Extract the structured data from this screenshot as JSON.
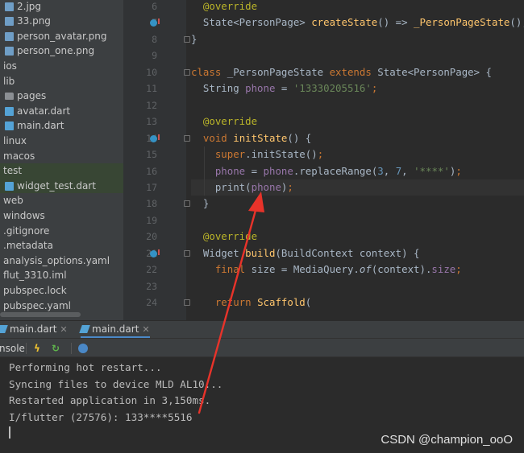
{
  "project_tree": {
    "items": [
      {
        "label": "2.jpg",
        "icon": "image-file-icon",
        "indent": 1
      },
      {
        "label": "33.png",
        "icon": "image-file-icon",
        "indent": 1
      },
      {
        "label": "person_avatar.png",
        "icon": "image-file-icon",
        "indent": 1
      },
      {
        "label": "person_one.png",
        "icon": "image-file-icon",
        "indent": 1
      },
      {
        "label": "ios",
        "icon": "",
        "indent": 0
      },
      {
        "label": "lib",
        "icon": "",
        "indent": 0
      },
      {
        "label": "pages",
        "icon": "folder-icon",
        "indent": 1
      },
      {
        "label": "avatar.dart",
        "icon": "dart-file-icon",
        "indent": 1
      },
      {
        "label": "main.dart",
        "icon": "dart-file-icon",
        "indent": 1
      },
      {
        "label": "linux",
        "icon": "",
        "indent": 0
      },
      {
        "label": "macos",
        "icon": "",
        "indent": 0
      },
      {
        "label": "test",
        "icon": "",
        "indent": 0,
        "selected": true
      },
      {
        "label": "widget_test.dart",
        "icon": "dart-file-icon",
        "indent": 1,
        "selected": true
      },
      {
        "label": "web",
        "icon": "",
        "indent": 0
      },
      {
        "label": "windows",
        "icon": "",
        "indent": 0
      },
      {
        "label": ".gitignore",
        "icon": "",
        "indent": 0
      },
      {
        "label": ".metadata",
        "icon": "",
        "indent": 0
      },
      {
        "label": "analysis_options.yaml",
        "icon": "",
        "indent": 0
      },
      {
        "label": "flut_3310.iml",
        "icon": "",
        "indent": 0
      },
      {
        "label": "pubspec.lock",
        "icon": "",
        "indent": 0
      },
      {
        "label": "pubspec.yaml",
        "icon": "",
        "indent": 0
      }
    ]
  },
  "editor": {
    "line_numbers": [
      "6",
      "7",
      "8",
      "9",
      "10",
      "11",
      "12",
      "13",
      "14",
      "15",
      "16",
      "17",
      "18",
      "19",
      "20",
      "21",
      "22",
      "23",
      "24"
    ],
    "lines": [
      [
        {
          "t": "  "
        },
        {
          "t": "@override",
          "c": "ann"
        }
      ],
      [
        {
          "t": "  State<PersonPage> "
        },
        {
          "t": "createState",
          "c": "fn"
        },
        {
          "t": "() => "
        },
        {
          "t": "_PersonPageState",
          "c": "fn"
        },
        {
          "t": "();"
        }
      ],
      [
        {
          "t": "}"
        }
      ],
      [
        {
          "t": ""
        }
      ],
      [
        {
          "t": "class ",
          "c": "kw"
        },
        {
          "t": "_PersonPageState "
        },
        {
          "t": "extends ",
          "c": "kw"
        },
        {
          "t": "State<PersonPage> {"
        }
      ],
      [
        {
          "t": "  String "
        },
        {
          "t": "phone",
          "c": "fld"
        },
        {
          "t": " = "
        },
        {
          "t": "'13330205516'",
          "c": "str"
        },
        {
          "t": ";",
          "c": "kw"
        }
      ],
      [
        {
          "t": ""
        }
      ],
      [
        {
          "t": "  "
        },
        {
          "t": "@override",
          "c": "ann"
        }
      ],
      [
        {
          "t": "  "
        },
        {
          "t": "void ",
          "c": "kw"
        },
        {
          "t": "initState",
          "c": "fn"
        },
        {
          "t": "() {"
        }
      ],
      [
        {
          "t": "    "
        },
        {
          "t": "super",
          "c": "kw"
        },
        {
          "t": ".initState()"
        },
        {
          "t": ";",
          "c": "kw"
        }
      ],
      [
        {
          "t": "    "
        },
        {
          "t": "phone",
          "c": "fld"
        },
        {
          "t": " = "
        },
        {
          "t": "phone",
          "c": "fld"
        },
        {
          "t": ".replaceRange("
        },
        {
          "t": "3",
          "c": "num"
        },
        {
          "t": ", "
        },
        {
          "t": "7",
          "c": "num"
        },
        {
          "t": ", "
        },
        {
          "t": "'****'",
          "c": "str"
        },
        {
          "t": ")"
        },
        {
          "t": ";",
          "c": "kw"
        }
      ],
      [
        {
          "t": "    print("
        },
        {
          "t": "phone",
          "c": "fld"
        },
        {
          "t": ")"
        },
        {
          "t": ";",
          "c": "kw"
        }
      ],
      [
        {
          "t": "  }"
        }
      ],
      [
        {
          "t": ""
        }
      ],
      [
        {
          "t": "  "
        },
        {
          "t": "@override",
          "c": "ann"
        }
      ],
      [
        {
          "t": "  Widget "
        },
        {
          "t": "build",
          "c": "fn"
        },
        {
          "t": "(BuildContext context) {"
        }
      ],
      [
        {
          "t": "    "
        },
        {
          "t": "final ",
          "c": "kw"
        },
        {
          "t": "size = MediaQuery."
        },
        {
          "t": "of",
          "c": "it"
        },
        {
          "t": "(context)."
        },
        {
          "t": "size",
          "c": "fld"
        },
        {
          "t": ";",
          "c": "kw"
        }
      ],
      [
        {
          "t": ""
        }
      ],
      [
        {
          "t": "    "
        },
        {
          "t": "return ",
          "c": "kw"
        },
        {
          "t": "Scaffold",
          "c": "fn"
        },
        {
          "t": "("
        }
      ]
    ]
  },
  "run_tabs": [
    {
      "label": "main.dart",
      "active": false
    },
    {
      "label": "main.dart",
      "active": true
    }
  ],
  "console_toolbar": {
    "console_label": "nsole"
  },
  "console": {
    "lines": [
      "Performing hot restart...",
      "Syncing files to device MLD AL10...",
      "Restarted application in 3,150ms.",
      "I/flutter (27576): 133****5516"
    ]
  },
  "watermark": "CSDN @champion_ooO",
  "colors": {
    "annotation_arrow": "#e8332a"
  }
}
